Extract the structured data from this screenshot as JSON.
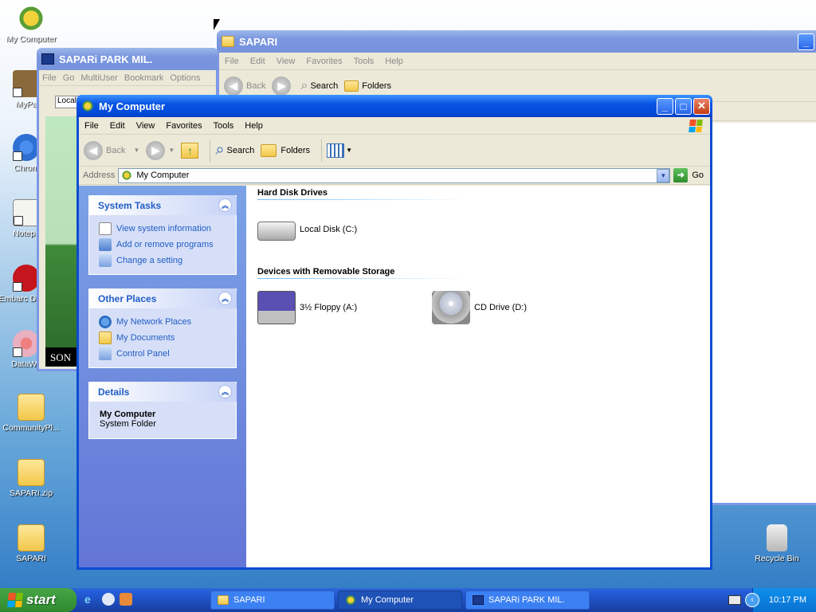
{
  "desktop": {
    "icons": [
      {
        "label": "My Computer"
      },
      {
        "label": "MyPa"
      },
      {
        "label": "Chrom"
      },
      {
        "label": "Notepa"
      },
      {
        "label": "Embarc Dev-C"
      },
      {
        "label": "DataWa"
      },
      {
        "label": "CommunityPl..."
      },
      {
        "label": "SAPARI.zip"
      },
      {
        "label": "SAPARI"
      },
      {
        "label": "Recycle Bin"
      }
    ]
  },
  "sapari_window": {
    "title": "SAPARI",
    "menus": [
      "File",
      "Edit",
      "View",
      "Favorites",
      "Tools",
      "Help"
    ],
    "back_label": "Back",
    "search_label": "Search",
    "folders_label": "Folders"
  },
  "sapari_park_window": {
    "title": "SAPARi PARK MIL.",
    "menus": [
      "File",
      "Go",
      "MultiUser",
      "Bookmark",
      "Options"
    ],
    "location_text": "Local",
    "bottom_text": "SON"
  },
  "my_computer_window": {
    "title": "My Computer",
    "menus": [
      "File",
      "Edit",
      "View",
      "Favorites",
      "Tools",
      "Help"
    ],
    "toolbar": {
      "back_label": "Back",
      "search_label": "Search",
      "folders_label": "Folders"
    },
    "address": {
      "label": "Address",
      "value": "My Computer",
      "go_label": "Go"
    },
    "task_pane": {
      "system_tasks": {
        "title": "System Tasks",
        "items": [
          "View system information",
          "Add or remove programs",
          "Change a setting"
        ]
      },
      "other_places": {
        "title": "Other Places",
        "items": [
          "My Network Places",
          "My Documents",
          "Control Panel"
        ]
      },
      "details": {
        "title": "Details",
        "name": "My Computer",
        "type": "System Folder"
      }
    },
    "content": {
      "hard_disk_section": "Hard Disk Drives",
      "hard_disks": [
        "Local Disk (C:)"
      ],
      "removable_section": "Devices with Removable Storage",
      "removable": [
        "3½ Floppy (A:)",
        "CD Drive (D:)"
      ]
    }
  },
  "taskbar": {
    "start_label": "start",
    "buttons": [
      "SAPARI",
      "My Computer",
      "SAPARi PARK MIL."
    ],
    "clock": "10:17 PM"
  },
  "colors": {
    "title_active": "#0a54e3",
    "task_link": "#215dc6",
    "start_green": "#3c9a3c"
  }
}
